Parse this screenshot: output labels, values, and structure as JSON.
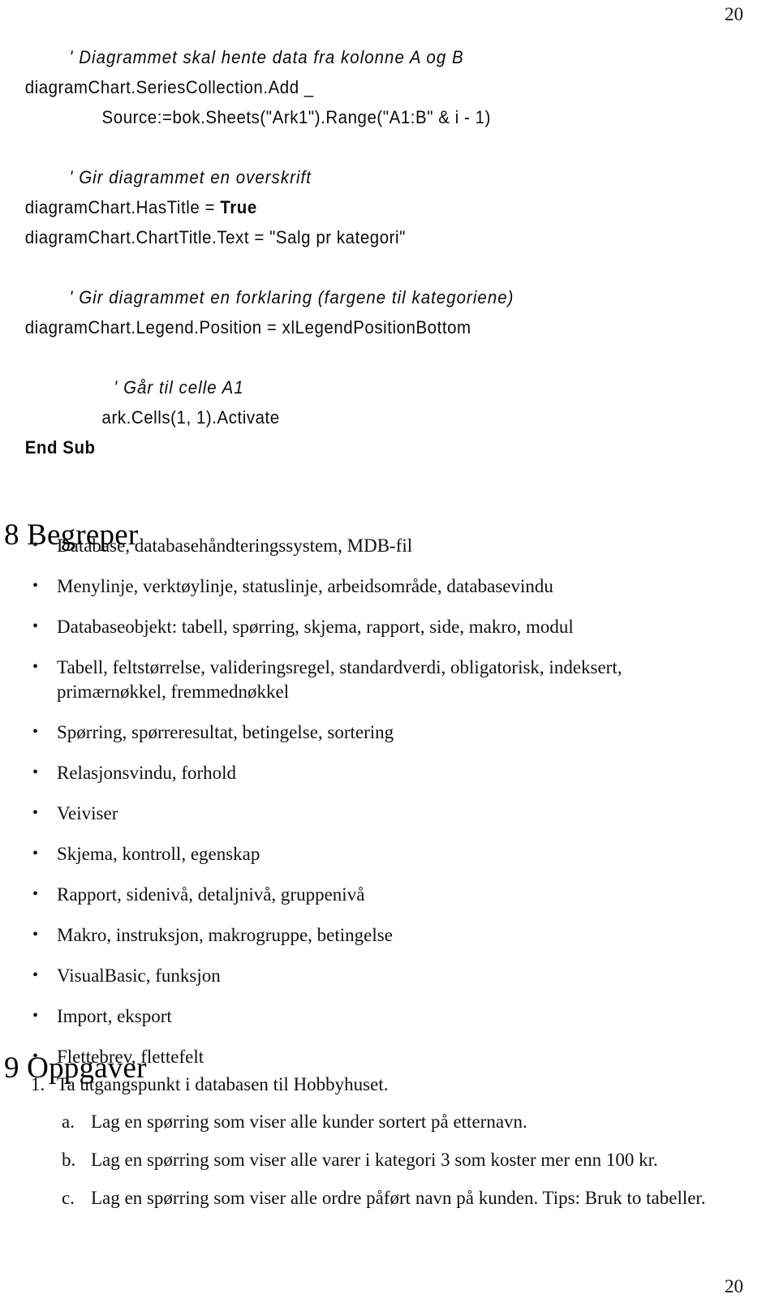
{
  "page": {
    "number_top": "20",
    "number_bottom": "20"
  },
  "code_listing": {
    "lines": [
      {
        "text": "' Diagrammet skal hente data fra kolonne A og B",
        "style": "comment",
        "indent": 1
      },
      {
        "text": "diagramChart.SeriesCollection.Add _",
        "style": "code",
        "indent": 0
      },
      {
        "text": "Source:=bok.Sheets(\"Ark1\").Range(\"A1:B\" & i - 1)",
        "style": "code",
        "indent": 2
      },
      {
        "text": "",
        "style": "blank",
        "indent": 0
      },
      {
        "text": "' Gir diagrammet en overskrift",
        "style": "comment",
        "indent": 1
      },
      {
        "text": "diagramChart.HasTitle = ",
        "style": "code",
        "indent": 0,
        "bold_tail": "True"
      },
      {
        "text": "diagramChart.ChartTitle.Text = \"Salg pr kategori\"",
        "style": "code",
        "indent": 0
      },
      {
        "text": "",
        "style": "blank",
        "indent": 0
      },
      {
        "text": "' Gir diagrammet en forklaring (fargene til kategoriene)",
        "style": "comment",
        "indent": 1
      },
      {
        "text": "diagramChart.Legend.Position = xlLegendPositionBottom",
        "style": "code",
        "indent": 0
      },
      {
        "text": "",
        "style": "blank",
        "indent": 0
      },
      {
        "text": "' Går til celle A1",
        "style": "comment",
        "indent": 3
      },
      {
        "text": "ark.Cells(1, 1).Activate",
        "style": "code",
        "indent": 2
      },
      {
        "text": "End Sub",
        "style": "code-bold",
        "indent": 0
      }
    ]
  },
  "sections": [
    {
      "id": "begreper",
      "heading": "8 Begreper",
      "bullet_glyph": "•",
      "bullets": [
        "Database, databasehåndteringssystem, MDB-fil",
        "Menylinje, verktøylinje, statuslinje, arbeidsområde, databasevindu",
        "Databaseobjekt: tabell, spørring, skjema, rapport, side, makro, modul",
        "Tabell, feltstørrelse, valideringsregel, standardverdi, obligatorisk, indeksert, primærnøkkel, fremmednøkkel",
        "Spørring, spørreresultat, betingelse, sortering",
        "Relasjonsvindu, forhold",
        "Veiviser",
        "Skjema, kontroll, egenskap",
        "Rapport, sidenivå, detaljnivå, gruppenivå",
        "Makro, instruksjon, makrogruppe, betingelse",
        "VisualBasic, funksjon",
        "Import, eksport",
        "Flettebrev, flettefelt"
      ]
    },
    {
      "id": "oppgaver",
      "heading": "9 Oppgaver",
      "tasks": [
        {
          "marker": "1.",
          "text": "Ta utgangspunkt i databasen til Hobbyhuset.",
          "subtasks": [
            {
              "marker": "a.",
              "text": "Lag en spørring som viser alle kunder sortert på etternavn."
            },
            {
              "marker": "b.",
              "text": "Lag en spørring som viser alle varer i kategori 3 som koster mer enn 100 kr."
            },
            {
              "marker": "c.",
              "text": "Lag en spørring som viser alle ordre påført navn på kunden. Tips: Bruk to tabeller."
            }
          ]
        }
      ]
    }
  ]
}
